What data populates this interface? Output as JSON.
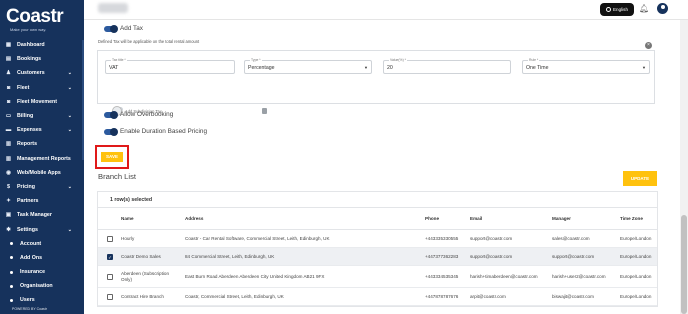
{
  "brand": {
    "name": "Coastr",
    "tagline": "Make your own way."
  },
  "sidebar": {
    "items": [
      {
        "label": "Dashboard",
        "icon": "dashboard-icon",
        "glyph": "▦",
        "chevron": false
      },
      {
        "label": "Bookings",
        "icon": "bookings-icon",
        "glyph": "▤",
        "chevron": false
      },
      {
        "label": "Customers",
        "icon": "customers-icon",
        "glyph": "♟",
        "chevron": true
      },
      {
        "label": "Fleet",
        "icon": "fleet-icon",
        "glyph": "◙",
        "chevron": true
      },
      {
        "label": "Fleet Movement",
        "icon": "fleet-movement-icon",
        "glyph": "◙",
        "chevron": false
      },
      {
        "label": "Billing",
        "icon": "billing-icon",
        "glyph": "▭",
        "chevron": true
      },
      {
        "label": "Expenses",
        "icon": "expenses-icon",
        "glyph": "▬",
        "chevron": true
      },
      {
        "label": "Reports",
        "icon": "reports-icon",
        "glyph": "▥",
        "chevron": false
      },
      {
        "label": "Management Reports",
        "icon": "management-reports-icon",
        "glyph": "▥",
        "chevron": false
      },
      {
        "label": "Web/Mobile Apps",
        "icon": "apps-icon",
        "glyph": "◉",
        "chevron": false
      },
      {
        "label": "Pricing",
        "icon": "pricing-icon",
        "glyph": "$",
        "chevron": true
      },
      {
        "label": "Partners",
        "icon": "partners-icon",
        "glyph": "✦",
        "chevron": false
      },
      {
        "label": "Task Manager",
        "icon": "task-manager-icon",
        "glyph": "▣",
        "chevron": false
      },
      {
        "label": "Settings",
        "icon": "settings-icon",
        "glyph": "✱",
        "chevron": true
      }
    ],
    "subitems": [
      "Account",
      "Add Ons",
      "Insurance",
      "Organisation",
      "Users"
    ],
    "powered_by": "POWERED BY Coastr"
  },
  "header": {
    "language": "English"
  },
  "tax": {
    "label": "Add Tax",
    "note": "Defined Tax will be applicable on the total rental amount",
    "fields": {
      "tax_title": {
        "label": "Tax title *",
        "value": "VAT"
      },
      "type": {
        "label": "Type *",
        "value": "Percentage"
      },
      "value": {
        "label": "Value(%) *",
        "value": "20"
      },
      "rule": {
        "label": "Rule *",
        "value": "One Time"
      }
    },
    "subdivision_label": "Add Subdivision Tax"
  },
  "toggles": {
    "overbooking": "Allow Overbooking",
    "duration_pricing": "Enable Duration Based Pricing"
  },
  "buttons": {
    "save": "SAVE",
    "update": "UPDATE"
  },
  "branch": {
    "title": "Branch List",
    "selected_text": "1 row(s) selected",
    "columns": [
      "Name",
      "Address",
      "Phone",
      "Email",
      "Manager",
      "Time Zone"
    ],
    "rows": [
      {
        "checked": false,
        "name": "Hourly",
        "address": "Coastr - Car Rental Software, Commercial Street, Leith, Edinburgh, UK",
        "phone": "+443335330555",
        "email": "support@coastr.com",
        "manager": "sales@coastr.com",
        "tz": "Europe/London"
      },
      {
        "checked": true,
        "name": "Coastr Demo Sales",
        "address": "84 Commercial Street, Leith, Edinburgh, UK",
        "phone": "+447377362283",
        "email": "support@coastr.com",
        "manager": "support@coastr.com",
        "tz": "Europe/London"
      },
      {
        "checked": false,
        "name": "Aberdeen (Subscription Only)",
        "address": "East Burn Road Aberdeen Aberdeen City United Kingdom AB21 9FX",
        "phone": "+443334535345",
        "email": "harish+timaberdeen@coastr.com",
        "manager": "harish+user2@coastr.com",
        "tz": "Europe/London"
      },
      {
        "checked": false,
        "name": "Contract Hire Branch",
        "address": "Coastr, Commercial Street, Leith, Edinburgh, UK",
        "phone": "+447878787676",
        "email": "arpit@coastr.com",
        "manager": "biswajit@coastr.com",
        "tz": "Europe/London"
      }
    ]
  }
}
